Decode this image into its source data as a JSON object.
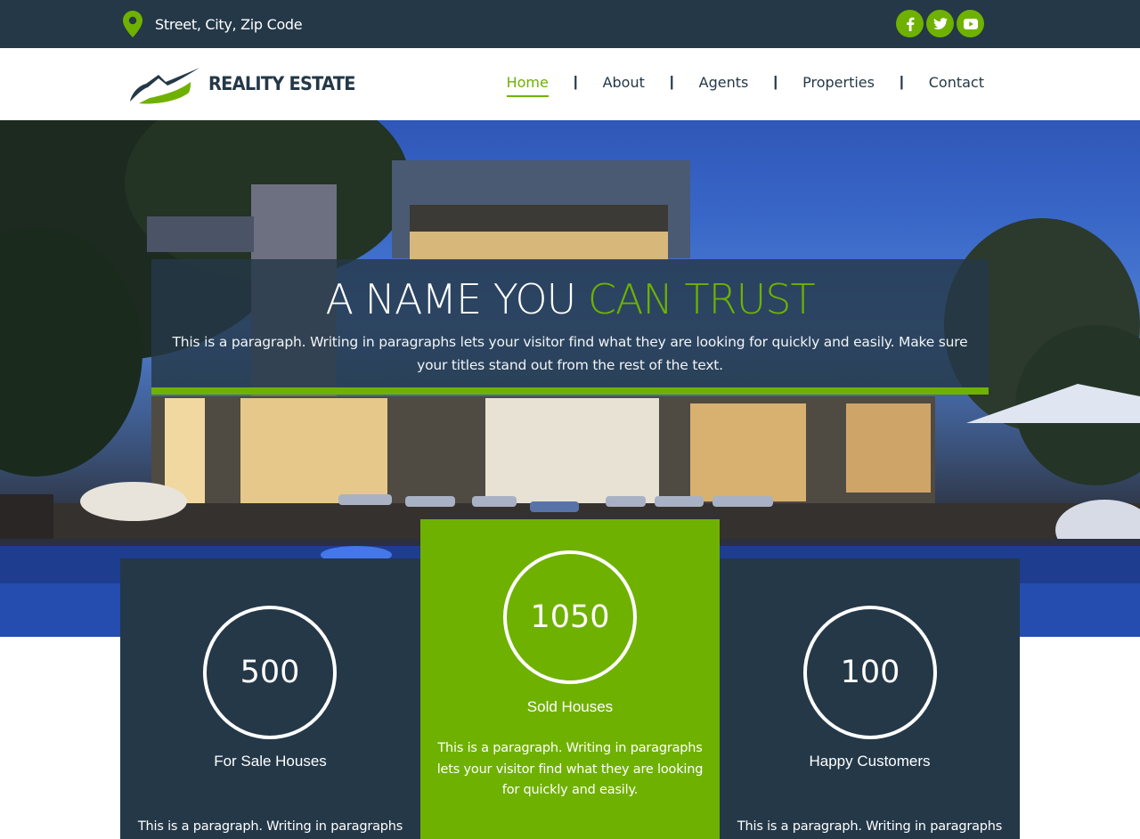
{
  "topbar": {
    "address": "Street, City, Zip Code",
    "social": [
      {
        "icon": "facebook-icon",
        "glyph": "f"
      },
      {
        "icon": "twitter-icon",
        "glyph": "t"
      },
      {
        "icon": "youtube-icon",
        "glyph": "▶"
      }
    ]
  },
  "header": {
    "logo_text": "REALITY ESTATE",
    "nav": [
      {
        "label": "Home",
        "active": true
      },
      {
        "label": "About"
      },
      {
        "label": "Agents"
      },
      {
        "label": "Properties"
      },
      {
        "label": "Contact"
      }
    ],
    "separator": "|"
  },
  "hero": {
    "title_white": "A NAME YOU",
    "title_green": "CAN TRUST",
    "paragraph": "This is a paragraph. Writing in paragraphs lets your visitor find what they are looking for quickly and easily. Make sure your titles stand out from the rest of the text."
  },
  "stats": [
    {
      "value": "500",
      "label": "For Sale Houses",
      "paragraph": "This is a paragraph. Writing in paragraphs"
    },
    {
      "value": "1050",
      "label": "Sold Houses",
      "paragraph": "This is a paragraph. Writing in paragraphs lets your visitor find what they are looking for quickly and easily."
    },
    {
      "value": "100",
      "label": "Happy Customers",
      "paragraph": "This is a paragraph. Writing in paragraphs"
    }
  ],
  "colors": {
    "navy": "#243848",
    "green": "#6fb100",
    "white": "#ffffff"
  }
}
